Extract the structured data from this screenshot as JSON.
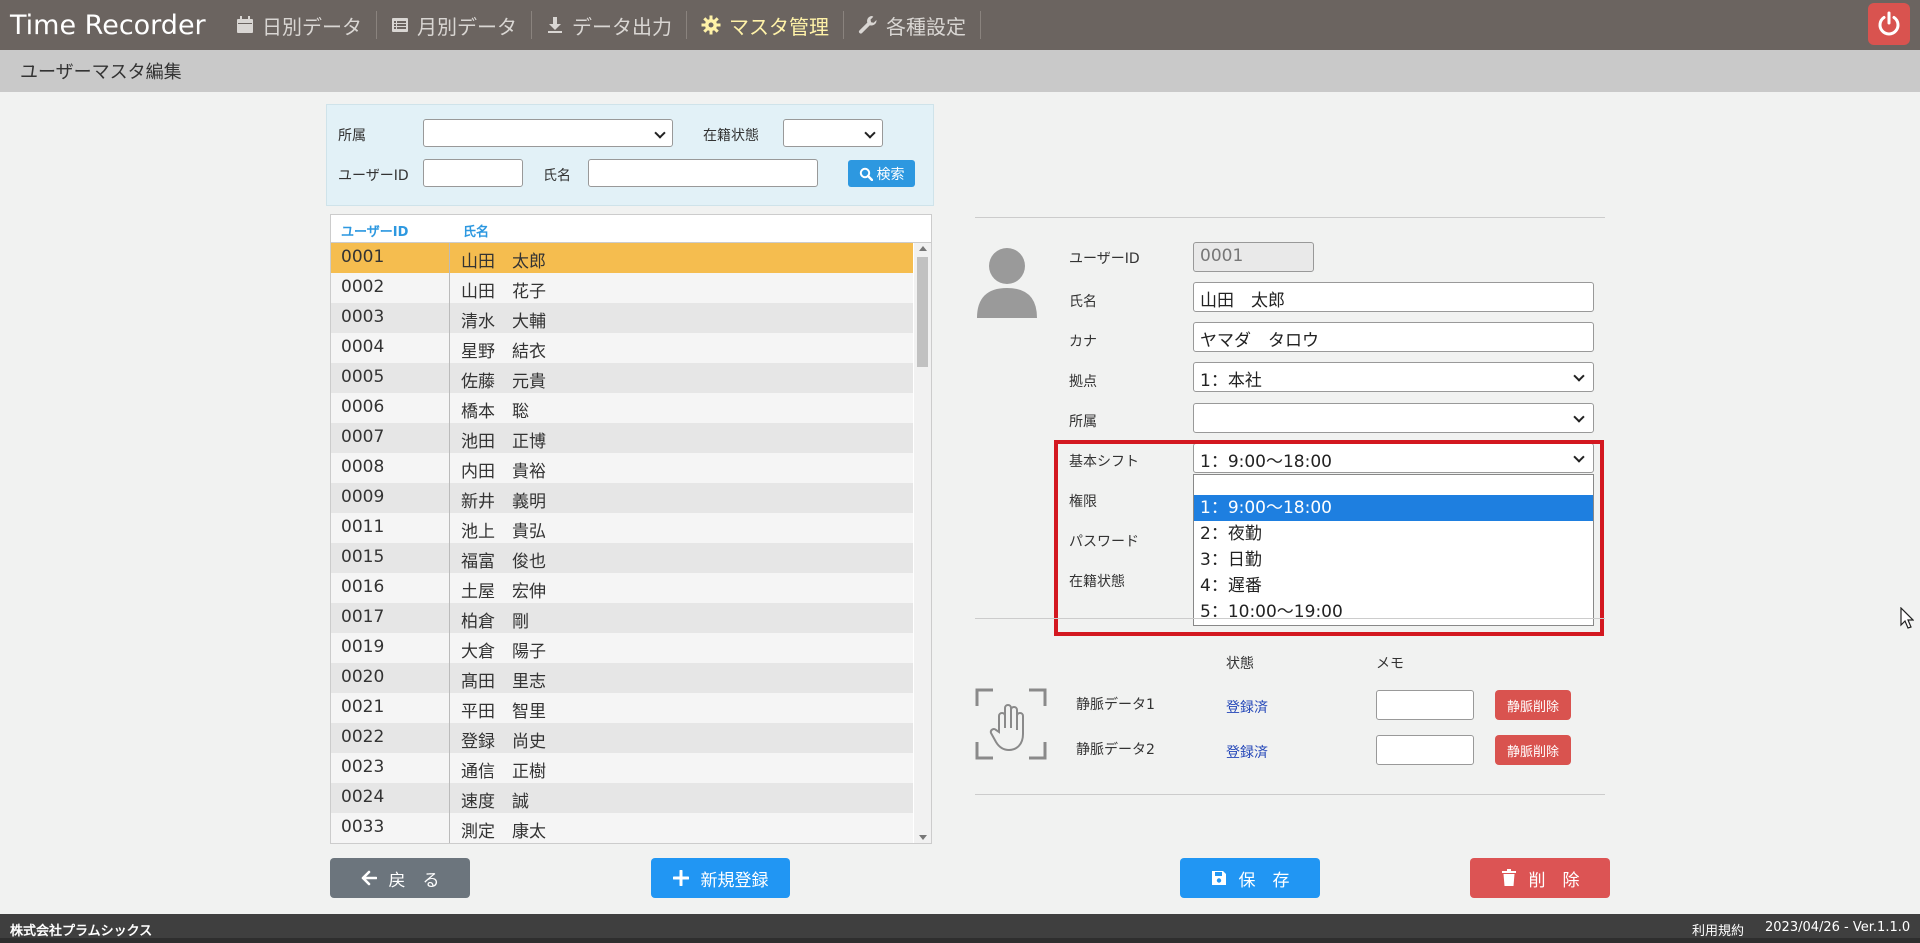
{
  "app": {
    "title": "Time Recorder"
  },
  "nav": [
    {
      "label": "日別データ",
      "icon": "calendar-icon"
    },
    {
      "label": "月別データ",
      "icon": "list-icon"
    },
    {
      "label": "データ出力",
      "icon": "download-icon"
    },
    {
      "label": "マスタ管理",
      "icon": "gear-icon",
      "active": true
    },
    {
      "label": "各種設定",
      "icon": "wrench-icon"
    }
  ],
  "page": {
    "title": "ユーザーマスタ編集"
  },
  "search": {
    "dept_label": "所属",
    "status_label": "在籍状態",
    "userid_label": "ユーザーID",
    "name_label": "氏名",
    "button_label": "検索"
  },
  "list": {
    "headers": [
      "ユーザーID",
      "氏名"
    ],
    "rows": [
      {
        "id": "0001",
        "name": "山田　太郎"
      },
      {
        "id": "0002",
        "name": "山田　花子"
      },
      {
        "id": "0003",
        "name": "清水　大輔"
      },
      {
        "id": "0004",
        "name": "星野　結衣"
      },
      {
        "id": "0005",
        "name": "佐藤　元貴"
      },
      {
        "id": "0006",
        "name": "橋本　聡"
      },
      {
        "id": "0007",
        "name": "池田　正博"
      },
      {
        "id": "0008",
        "name": "内田　貴裕"
      },
      {
        "id": "0009",
        "name": "新井　義明"
      },
      {
        "id": "0011",
        "name": "池上　貴弘"
      },
      {
        "id": "0015",
        "name": "福富　俊也"
      },
      {
        "id": "0016",
        "name": "土屋　宏伸"
      },
      {
        "id": "0017",
        "name": "柏倉　剛"
      },
      {
        "id": "0019",
        "name": "大倉　陽子"
      },
      {
        "id": "0020",
        "name": "髙田　里志"
      },
      {
        "id": "0021",
        "name": "平田　智里"
      },
      {
        "id": "0022",
        "name": "登録　尚史"
      },
      {
        "id": "0023",
        "name": "通信　正樹"
      },
      {
        "id": "0024",
        "name": "速度　誠"
      },
      {
        "id": "0033",
        "name": "測定　康太"
      }
    ]
  },
  "form": {
    "userid_label": "ユーザーID",
    "userid_value": "0001",
    "name_label": "氏名",
    "name_value": "山田　太郎",
    "kana_label": "カナ",
    "kana_value": "ヤマダ　タロウ",
    "site_label": "拠点",
    "site_value": "1：本社",
    "dept_label": "所属",
    "dept_value": "",
    "shift_label": "基本シフト",
    "shift_value": "1：9:00〜18:00",
    "role_label": "権限",
    "password_label": "パスワード",
    "status_label": "在籍状態"
  },
  "shift_dropdown": {
    "options": [
      "",
      "1：9:00〜18:00",
      "2：夜勤",
      "3：日勤",
      "4：遅番",
      "5：10:00〜19:00"
    ],
    "selected_index": 1
  },
  "vein": {
    "status_header": "状態",
    "memo_header": "メモ",
    "items": [
      {
        "label": "静脈データ1",
        "status": "登録済",
        "button": "静脈削除"
      },
      {
        "label": "静脈データ2",
        "status": "登録済",
        "button": "静脈削除"
      }
    ]
  },
  "buttons": {
    "back": "戻　る",
    "new": "新規登録",
    "save": "保　存",
    "delete": "削　除"
  },
  "footer": {
    "company": "株式会社プラムシックス",
    "terms": "利用規約",
    "version": "2023/04/26 - Ver.1.1.0"
  },
  "colors": {
    "topbar": "#6b6460",
    "selected_row": "#f5bd4f",
    "primary": "#2d98e0",
    "danger": "#d9534f",
    "highlight": "#d31820"
  }
}
